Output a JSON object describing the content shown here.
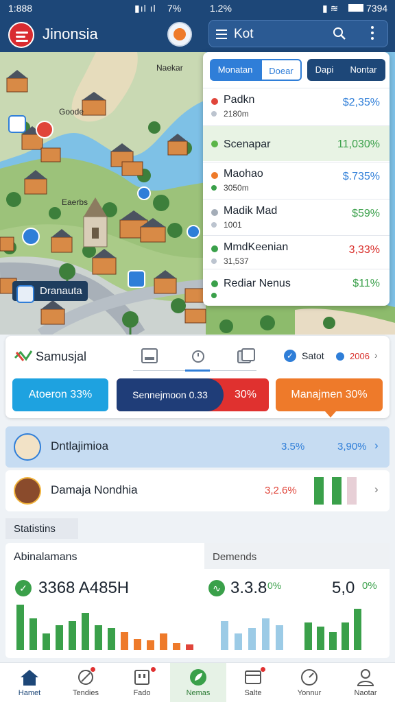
{
  "status": {
    "left_time": "1:888",
    "left_battery": "7%",
    "right_time": "1.2%",
    "right_clock": "7394"
  },
  "header": {
    "app_title": "Jinonsia"
  },
  "search": {
    "value": "Kot"
  },
  "map": {
    "labels": [
      "Naekar",
      "Goode",
      "Eaerbs"
    ],
    "location_chip": "Dranauta"
  },
  "panel": {
    "tabs": [
      "Monatan",
      "Doear",
      "Dapi",
      "Nontar"
    ],
    "items": [
      {
        "name": "Padkn",
        "sub": "2180m",
        "value": "$2,35%",
        "color": "#2f7ed8",
        "dot": "#e0453a"
      },
      {
        "name": "Scenapar",
        "sub": "",
        "value": "11,030%",
        "color": "#3aa04a",
        "dot": "#5bb548"
      },
      {
        "name": "Maohao",
        "sub": "3050m",
        "value": "$.735%",
        "color": "#2f7ed8",
        "dot": "#ee7a2a"
      },
      {
        "name": "Madik Mad",
        "sub": "1001",
        "value": "$59%",
        "color": "#3aa04a",
        "dot": "#a4adb8"
      },
      {
        "name": "MmdKeenian",
        "sub": "31,537",
        "value": "3,33%",
        "color": "#d9302c",
        "dot": "#3aa04a"
      },
      {
        "name": "Rediar Nenus",
        "sub": "",
        "value": "$11%",
        "color": "#3aa04a",
        "dot": "#3aa04a"
      }
    ]
  },
  "filter": {
    "brand": "Samusjal",
    "toggle_label": "Satot",
    "year": "2006",
    "pills": [
      {
        "label": "Atoeron",
        "value": "33%",
        "color": "#1ea2e0"
      },
      {
        "label": "Sennejmoon 0.33",
        "value": "30%",
        "color": "#1f3d78"
      },
      {
        "label": "Manajmen",
        "value": "30%",
        "color": "#ee7a2a"
      }
    ]
  },
  "list": [
    {
      "name": "Dntlajimioa",
      "value_a": "3.5%",
      "value_b": "3,90%",
      "accent": "#2f7ed8"
    },
    {
      "name": "Damaja Nondhia",
      "value_a": "3,2.6%",
      "accent": "#e0453a"
    }
  ],
  "stats": {
    "section_title": "Statistins",
    "left_title": "Abinalamans",
    "left_value": "3368 A485H",
    "right_title": "Demends",
    "right_value": "3.3.8",
    "right_value_small": "0%",
    "right_big": "5,0",
    "right_big_small": "0%"
  },
  "nav": [
    {
      "label": "Hamet",
      "icon": "home-icon"
    },
    {
      "label": "Tendies",
      "icon": "compass-icon"
    },
    {
      "label": "Fado",
      "icon": "calendar-icon"
    },
    {
      "label": "Nemas",
      "icon": "leaf-icon"
    },
    {
      "label": "Salte",
      "icon": "inbox-icon"
    },
    {
      "label": "Yonnur",
      "icon": "gauge-icon"
    },
    {
      "label": "Naotar",
      "icon": "person-icon"
    }
  ]
}
